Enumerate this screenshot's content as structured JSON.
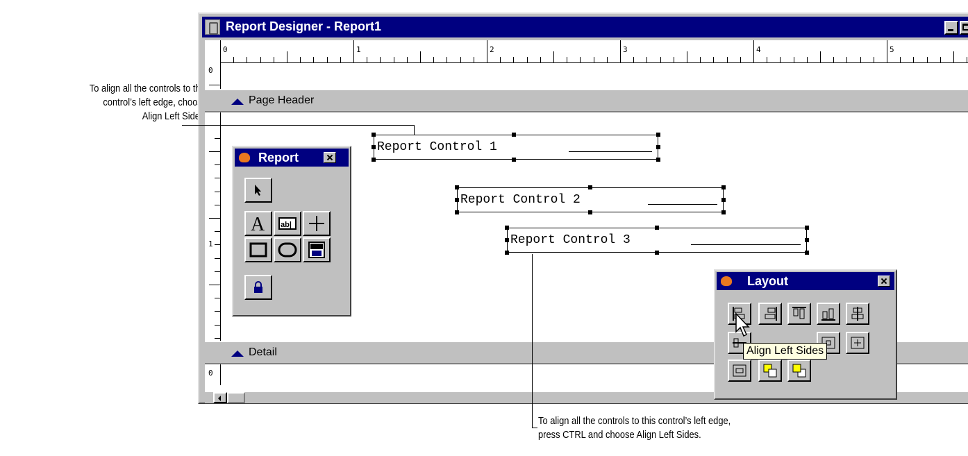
{
  "callouts": {
    "top": [
      "To align all the controls to this",
      "control’s left edge, choose",
      "Align Left Sides."
    ],
    "bottom": [
      "To align all the controls to this control’s left edge,",
      "press CTRL and choose Align Left Sides."
    ]
  },
  "window": {
    "title": "Report Designer - Report1",
    "ruler_h": [
      "0",
      "1",
      "2",
      "3",
      "4",
      "5"
    ],
    "ruler_v": [
      "0",
      "1"
    ],
    "ruler_v_detail": "0"
  },
  "bands": {
    "page_header": "Page Header",
    "detail": "Detail"
  },
  "controls": [
    "Report Control 1",
    "Report Control 2",
    "Report Control 3"
  ],
  "report_toolbar": {
    "title": "Report",
    "buttons": [
      "pointer",
      "label",
      "field",
      "line",
      "rectangle",
      "rounded-rectangle",
      "ole-bound",
      "button-lock"
    ]
  },
  "layout_toolbar": {
    "title": "Layout"
  },
  "tooltip": "Align Left Sides",
  "colors": {
    "title_bar": "#000080",
    "face": "#c0c0c0",
    "tooltip": "#ffffe1"
  }
}
